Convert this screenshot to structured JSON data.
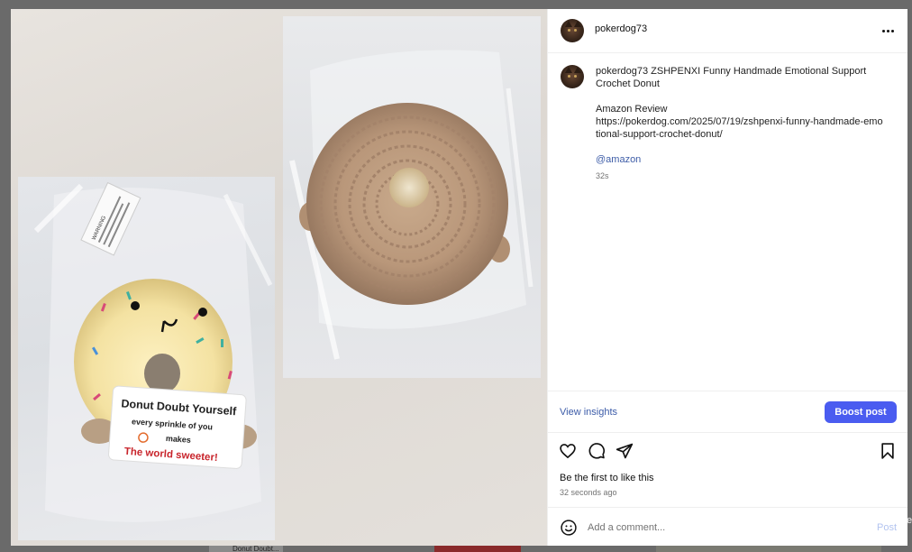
{
  "post": {
    "username": "pokerdog73",
    "caption_title": "ZSHPENXI Funny Handmade Emotional Support Crochet Donut",
    "caption_label": "Amazon Review",
    "caption_link": "https://pokerdog.com/2025/07/19/zshpenxi-funny-handmade-emotional-support-crochet-donut/",
    "mention": "@amazon",
    "time_short": "32s"
  },
  "insights": {
    "view_label": "View insights",
    "boost_label": "Boost post"
  },
  "engagement": {
    "likes_text": "Be the first to like this",
    "time_ago": "32 seconds ago"
  },
  "comment": {
    "placeholder": "Add a comment...",
    "post_label": "Post"
  },
  "card": {
    "line1": "Donut Doubt Yourself",
    "line2": "every sprinkle of you",
    "line3": "makes",
    "line4": "The world sweeter!"
  },
  "package_label": "WARNING",
  "background_peek": "Donut Doubt...",
  "icons": {
    "more": "more-horizontal-icon",
    "like": "heart-icon",
    "comment": "comment-icon",
    "share": "send-icon",
    "save": "bookmark-icon",
    "emoji": "emoji-icon"
  },
  "colors": {
    "accent": "#4a5cf0",
    "link": "#3b5ba8",
    "post_disabled": "#b3c4f0"
  }
}
